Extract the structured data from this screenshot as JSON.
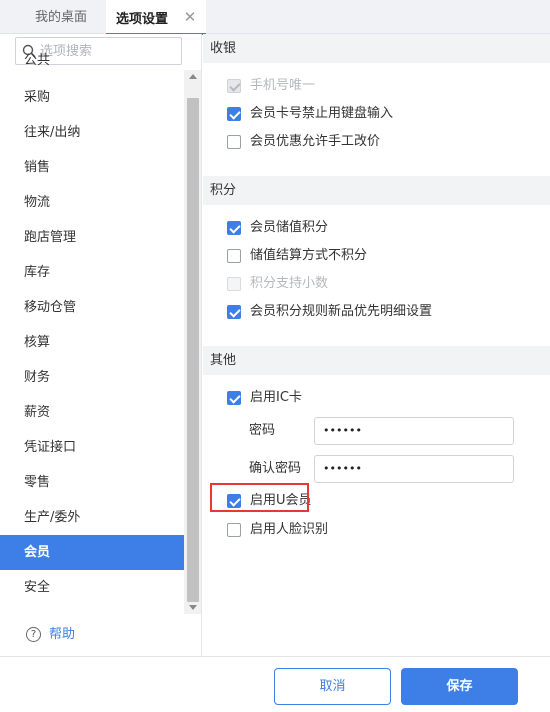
{
  "tabs": [
    {
      "label": "我的桌面"
    },
    {
      "label": "选项设置"
    }
  ],
  "search": {
    "placeholder": "选项搜索"
  },
  "sidebar": {
    "items": [
      {
        "label": "公共"
      },
      {
        "label": "采购"
      },
      {
        "label": "往来/出纳"
      },
      {
        "label": "销售"
      },
      {
        "label": "物流"
      },
      {
        "label": "跑店管理"
      },
      {
        "label": "库存"
      },
      {
        "label": "移动仓管"
      },
      {
        "label": "核算"
      },
      {
        "label": "财务"
      },
      {
        "label": "薪资"
      },
      {
        "label": "凭证接口"
      },
      {
        "label": "零售"
      },
      {
        "label": "生产/委外"
      },
      {
        "label": "会员"
      },
      {
        "label": "安全"
      }
    ],
    "active_index": 14,
    "help_label": "帮助"
  },
  "sections": {
    "cashier": {
      "title": "收银",
      "options": [
        {
          "label": "手机号唯一",
          "checked": true,
          "disabled": true
        },
        {
          "label": "会员卡号禁止用键盘输入",
          "checked": true,
          "disabled": false
        },
        {
          "label": "会员优惠允许手工改价",
          "checked": false,
          "disabled": false
        }
      ]
    },
    "points": {
      "title": "积分",
      "options": [
        {
          "label": "会员储值积分",
          "checked": true,
          "disabled": false
        },
        {
          "label": "储值结算方式不积分",
          "checked": false,
          "disabled": false
        },
        {
          "label": "积分支持小数",
          "checked": false,
          "disabled": true
        },
        {
          "label": "会员积分规则新品优先明细设置",
          "checked": true,
          "disabled": false
        }
      ]
    },
    "other": {
      "title": "其他",
      "ic_card": {
        "label": "启用IC卡",
        "checked": true
      },
      "password": {
        "label": "密码",
        "value": "••••••"
      },
      "confirm_password": {
        "label": "确认密码",
        "value": "••••••"
      },
      "u_member": {
        "label": "启用U会员",
        "checked": true
      },
      "face_id": {
        "label": "启用人脸识别",
        "checked": false
      }
    }
  },
  "footer": {
    "cancel_label": "取消",
    "save_label": "保存"
  },
  "colors": {
    "accent": "#3d7fe6",
    "highlight": "#e53935"
  }
}
